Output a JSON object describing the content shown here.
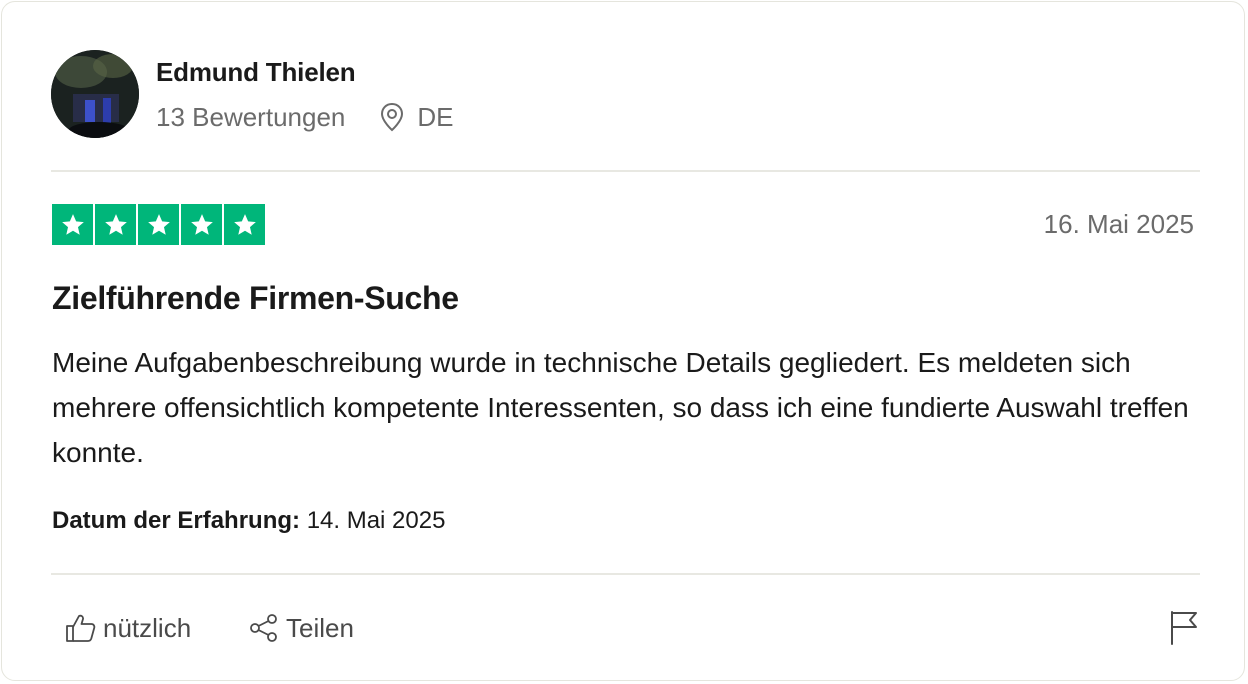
{
  "reviewer": {
    "name": "Edmund Thielen",
    "review_count": "13 Bewertungen",
    "country": "DE"
  },
  "review": {
    "rating": 5,
    "date": "16. Mai 2025",
    "title": "Zielführende Firmen-Suche",
    "body": "Meine Aufgabenbeschreibung wurde in technische Details gegliedert. Es meldeten sich mehrere offensichtlich kompetente Interessenten, so dass ich eine fundierte Auswahl treffen konnte.",
    "experience_label": "Datum der Erfahrung:",
    "experience_date": "14. Mai 2025"
  },
  "actions": {
    "useful_label": "nützlich",
    "share_label": "Teilen"
  },
  "icons": {
    "location": "location-pin-icon",
    "useful": "thumbs-up-icon",
    "share": "share-icon",
    "report": "flag-icon",
    "star": "star-icon"
  },
  "colors": {
    "star_green": "#00b67a",
    "muted_text": "#6b6b6b",
    "divider": "#e8e8e2"
  }
}
